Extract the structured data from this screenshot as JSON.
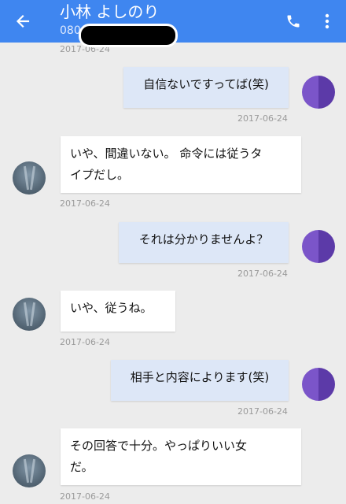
{
  "header": {
    "contact_name": "小林 よしのり",
    "phone_prefix": "080",
    "color": "#3f86f0",
    "back_icon": "arrow-left-icon",
    "call_icon": "phone-icon",
    "more_icon": "more-vertical-icon"
  },
  "top_timestamp": "2017-06-24",
  "messages": [
    {
      "direction": "outgoing",
      "lines": [
        "自信ないですってば(笑)"
      ],
      "timestamp": "2017-06-24"
    },
    {
      "direction": "incoming",
      "lines": [
        "いや、間違いない。 命令には従うタ",
        "イプだし。"
      ],
      "timestamp": "2017-06-24"
    },
    {
      "direction": "outgoing",
      "lines": [
        "それは分かりませんよ？"
      ],
      "timestamp": "2017-06-24"
    },
    {
      "direction": "incoming",
      "lines": [
        "いや、従うね。"
      ],
      "timestamp": "2017-06-24"
    },
    {
      "direction": "outgoing",
      "lines": [
        "相手と内容によります(笑)"
      ],
      "timestamp": "2017-06-24"
    },
    {
      "direction": "incoming",
      "lines": [
        "その回答で十分。やっぱりいい女",
        "だ。"
      ],
      "timestamp": "2017-06-24"
    }
  ]
}
